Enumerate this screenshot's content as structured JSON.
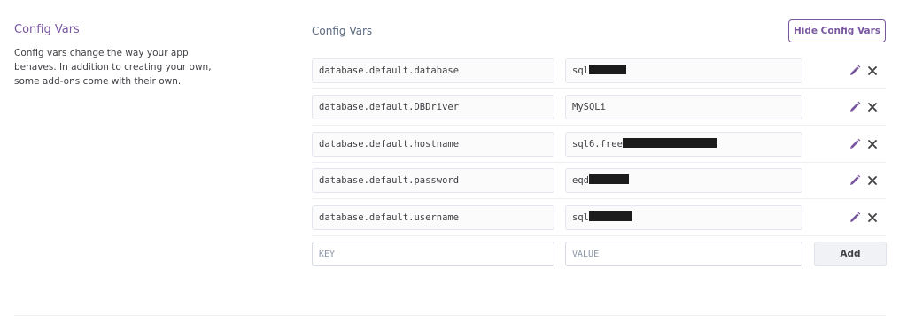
{
  "sidebar": {
    "title": "Config Vars",
    "description": "Config vars change the way your app behaves. In addition to creating your own, some add-ons come with their own."
  },
  "main": {
    "title": "Config Vars",
    "hide_button": "Hide Config Vars",
    "vars": [
      {
        "key": "database.default.database",
        "value_visible": "sql",
        "masked": true
      },
      {
        "key": "database.default.DBDriver",
        "value_visible": "MySQLi",
        "masked": false
      },
      {
        "key": "database.default.hostname",
        "value_visible": "sql6.free",
        "masked": true
      },
      {
        "key": "database.default.password",
        "value_visible": "eqd",
        "masked": true
      },
      {
        "key": "database.default.username",
        "value_visible": "sql",
        "masked": true
      }
    ],
    "new_var": {
      "key_placeholder": "KEY",
      "value_placeholder": "VALUE",
      "add_label": "Add"
    }
  },
  "icons": {
    "edit": "pencil-icon",
    "delete": "close-icon"
  },
  "colors": {
    "accent": "#79589f",
    "text": "#3f3f44",
    "mask": "#1c1c1c"
  }
}
